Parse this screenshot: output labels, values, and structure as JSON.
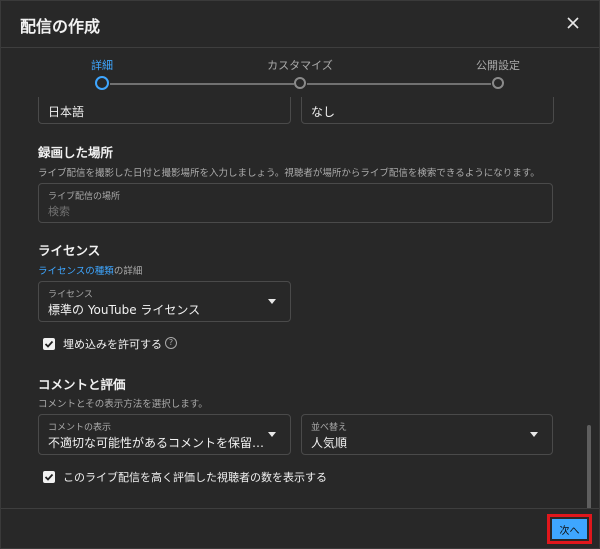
{
  "dialog": {
    "title": "配信の作成",
    "close_icon": "close-icon"
  },
  "stepper": {
    "steps": [
      {
        "label": "詳細",
        "active": true
      },
      {
        "label": "カスタマイズ",
        "active": false
      },
      {
        "label": "公開設定",
        "active": false
      }
    ]
  },
  "top_fields": {
    "language_value": "日本語",
    "second_value": "なし"
  },
  "recording_location": {
    "title": "録画した場所",
    "description": "ライブ配信を撮影した日付と撮影場所を入力しましょう。視聴者が場所からライブ配信を検索できるようになります。",
    "field_label": "ライブ配信の場所",
    "field_placeholder": "検索"
  },
  "license": {
    "title": "ライセンス",
    "link_text": "ライセンスの種類",
    "link_suffix": "の詳細",
    "field_label": "ライセンス",
    "field_value": "標準の YouTube ライセンス"
  },
  "embedding": {
    "label": "埋め込みを許可する",
    "checked": true,
    "help_icon": "help-circle-icon"
  },
  "comments": {
    "title": "コメントと評価",
    "description": "コメントとその表示方法を選択します。",
    "display_label": "コメントの表示",
    "display_value": "不適切な可能性があるコメントを保留し...",
    "sort_label": "並べ替え",
    "sort_value": "人気順"
  },
  "likes": {
    "label": "このライブ配信を高く評価した視聴者の数を表示する",
    "checked": true
  },
  "footer": {
    "next_label": "次へ"
  },
  "colors": {
    "accent": "#3ea6ff",
    "highlight": "#e0171c",
    "background": "#282828"
  }
}
